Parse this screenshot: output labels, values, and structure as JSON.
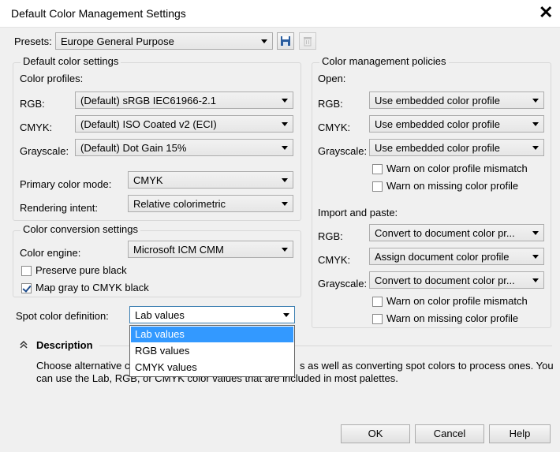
{
  "window": {
    "title": "Default Color Management Settings",
    "close_glyph": "✕"
  },
  "presets": {
    "label": "Presets:",
    "value": "Europe General Purpose",
    "save_icon": "floppy-disk-icon",
    "delete_icon": "trash-icon"
  },
  "default_color_settings": {
    "legend": "Default color settings",
    "profiles_label": "Color profiles:",
    "rgb_label": "RGB:",
    "rgb_value": "(Default) sRGB IEC61966-2.1",
    "cmyk_label": "CMYK:",
    "cmyk_value": "(Default) ISO Coated v2 (ECI)",
    "gray_label": "Grayscale:",
    "gray_value": "(Default) Dot Gain 15%",
    "primary_label": "Primary color mode:",
    "primary_value": "CMYK",
    "intent_label": "Rendering intent:",
    "intent_value": "Relative colorimetric"
  },
  "color_conversion": {
    "legend": "Color conversion settings",
    "engine_label": "Color engine:",
    "engine_value": "Microsoft ICM CMM",
    "preserve_black_label": "Preserve pure black",
    "preserve_black_checked": false,
    "map_gray_label": "Map gray to CMYK black",
    "map_gray_checked": true
  },
  "spot": {
    "label": "Spot color definition:",
    "value": "Lab values",
    "options": [
      "Lab values",
      "RGB values",
      "CMYK values"
    ],
    "selected_index": 0
  },
  "policies": {
    "legend": "Color management policies",
    "open_label": "Open:",
    "rgb_label": "RGB:",
    "open_rgb": "Use embedded color profile",
    "cmyk_label": "CMYK:",
    "open_cmyk": "Use embedded color profile",
    "gray_label": "Grayscale:",
    "open_gray": "Use embedded color profile",
    "warn_mismatch": "Warn on color profile mismatch",
    "warn_missing": "Warn on missing color profile",
    "import_label": "Import and paste:",
    "import_rgb": "Convert to document color pr...",
    "import_cmyk": "Assign document color profile",
    "import_gray": "Convert to document color pr..."
  },
  "description": {
    "heading": "Description",
    "toggle_icon": "double-chevron-up-icon",
    "text_line1_left": "Choose alternative c",
    "text_line1_right": "s as well as converting spot colors to process ones. You",
    "text_line2": "can use the Lab, RGB, or CMYK color values that are included in most palettes."
  },
  "buttons": {
    "ok": "OK",
    "cancel": "Cancel",
    "help": "Help"
  },
  "colors": {
    "selection": "#3399ff",
    "dialog_bg": "#f0f0f0",
    "focus_border": "#3c7fb1"
  }
}
